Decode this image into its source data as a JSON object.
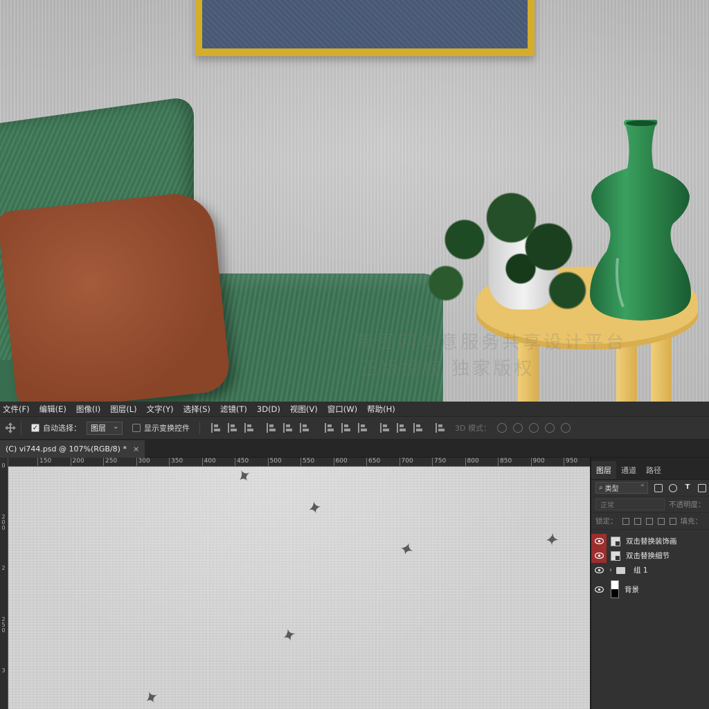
{
  "mockup": {
    "watermark_line1": "新图网创意服务共享设计平台",
    "watermark_line2": "正版授权 独家版权"
  },
  "menubar": {
    "items": [
      "文件(F)",
      "编辑(E)",
      "图像(I)",
      "图层(L)",
      "文字(Y)",
      "选择(S)",
      "滤镜(T)",
      "3D(D)",
      "视图(V)",
      "窗口(W)",
      "帮助(H)"
    ]
  },
  "options_bar": {
    "auto_select_checked": "✓",
    "auto_select_label": "自动选择：",
    "auto_select_target": "图层",
    "show_transform_label": "显示变换控件",
    "mode_3d_label": "3D 模式："
  },
  "document_tab": {
    "title": "(C) vi744.psd @ 107%(RGB/8) *",
    "close": "×"
  },
  "ruler": {
    "horizontal_ticks": [
      "150",
      "200",
      "250",
      "300",
      "350",
      "400",
      "450",
      "500",
      "550",
      "600",
      "650",
      "700",
      "750",
      "800",
      "850",
      "900",
      "950"
    ],
    "vertical_ticks": [
      "0",
      "200",
      "2",
      "250",
      "3"
    ]
  },
  "layers_panel": {
    "tabs": [
      "图层",
      "通道",
      "路径"
    ],
    "filter_kind": "类型",
    "blend_mode": "正常",
    "opacity_label": "不透明度：",
    "lock_label": "锁定：",
    "fill_label": "填充：",
    "layers": [
      {
        "name": "双击替换装饰画",
        "visible_highlight": true,
        "type": "smart"
      },
      {
        "name": "双击替换细节",
        "visible_highlight": true,
        "type": "smart"
      },
      {
        "name": "组 1",
        "visible_highlight": false,
        "type": "group"
      },
      {
        "name": "背景",
        "visible_highlight": false,
        "type": "background"
      }
    ]
  },
  "colors": {
    "accent_eye_highlight": "#9c2e2e",
    "panel_bg": "#323232",
    "frame_gold": "#d4ad2a",
    "armchair_green": "#3f7a57",
    "pillow_brown": "#a45b3c",
    "table_yellow": "#e9c46a",
    "vase_green": "#2f8a4e"
  }
}
